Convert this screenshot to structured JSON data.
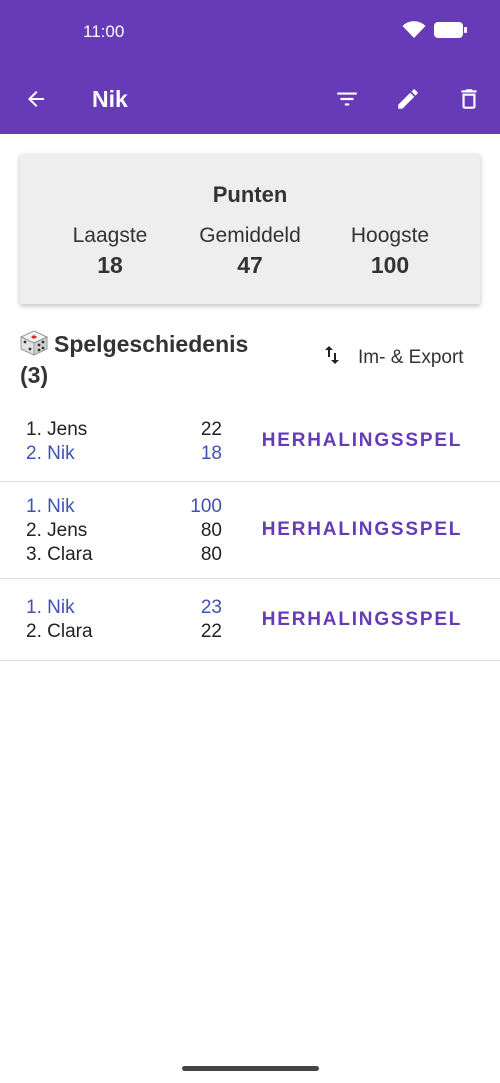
{
  "status_bar": {
    "time": "11:00",
    "icons": [
      "wifi-icon",
      "battery-icon"
    ]
  },
  "toolbar": {
    "title": "Nik",
    "icons": [
      "back-arrow-icon",
      "filter-icon",
      "edit-pencil-icon",
      "delete-icon"
    ]
  },
  "colors": {
    "primary": "#673ab7",
    "self_highlight": "#3f51b5",
    "card_bg": "#eeeeee"
  },
  "points_card": {
    "title": "Punten",
    "stats": [
      {
        "label": "Laagste",
        "value": "18"
      },
      {
        "label": "Gemiddeld",
        "value": "47"
      },
      {
        "label": "Hoogste",
        "value": "100"
      }
    ]
  },
  "history": {
    "title": "Spelgeschiedenis",
    "count": "(3)",
    "export_label": "Im- & Export",
    "games": [
      {
        "players": [
          {
            "name": "1. Jens",
            "score": "22",
            "self": false
          },
          {
            "name": "2. Nik",
            "score": "18",
            "self": true
          }
        ],
        "repeat_label": "HERHALINGSSPEL"
      },
      {
        "players": [
          {
            "name": "1. Nik",
            "score": "100",
            "self": true
          },
          {
            "name": "2. Jens",
            "score": "80",
            "self": false
          },
          {
            "name": "3. Clara",
            "score": "80",
            "self": false
          }
        ],
        "repeat_label": "HERHALINGSSPEL"
      },
      {
        "players": [
          {
            "name": "1. Nik",
            "score": "23",
            "self": true
          },
          {
            "name": "2. Clara",
            "score": "22",
            "self": false
          }
        ],
        "repeat_label": "HERHALINGSSPEL"
      }
    ]
  }
}
